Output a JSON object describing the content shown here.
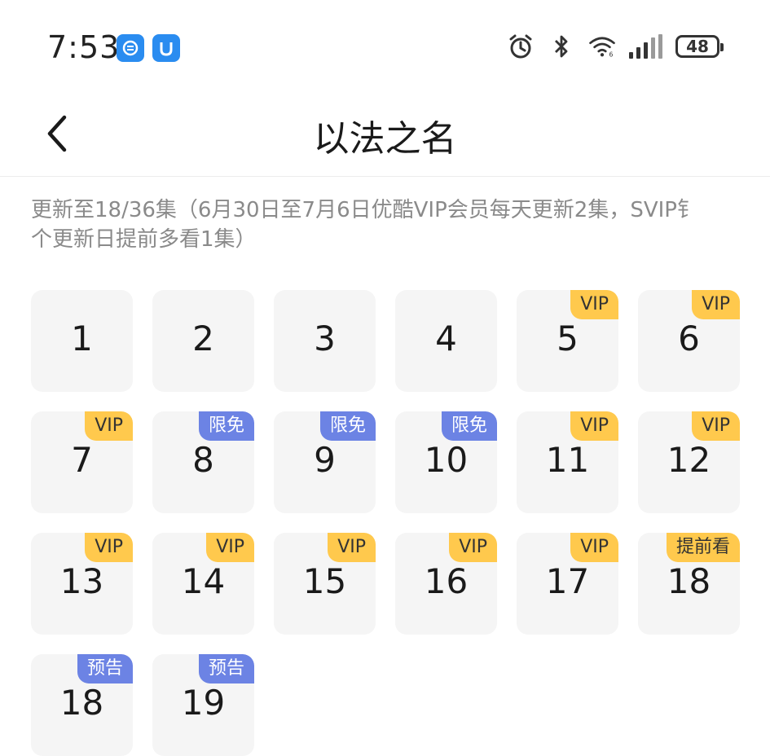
{
  "status_bar": {
    "time": "7:53",
    "battery": "48",
    "icons": [
      "app-sync-icon",
      "app-shield-icon",
      "alarm-icon",
      "bluetooth-icon",
      "wifi-icon",
      "signal-icon",
      "battery-icon"
    ]
  },
  "header": {
    "title": "以法之名",
    "back_icon": "chevron-left-icon"
  },
  "description": {
    "line1": "更新至18/36集（6月30日至7月6日优酷VIP会员每天更新2集，SVIP钅",
    "line2": "个更新日提前多看1集）"
  },
  "colors": {
    "vip_badge": "#ffc94d",
    "free_badge": "#6c83e4",
    "tile_bg": "#f5f5f5"
  },
  "episodes": [
    {
      "num": "1",
      "badge": ""
    },
    {
      "num": "2",
      "badge": ""
    },
    {
      "num": "3",
      "badge": ""
    },
    {
      "num": "4",
      "badge": ""
    },
    {
      "num": "5",
      "badge": "VIP"
    },
    {
      "num": "6",
      "badge": "VIP"
    },
    {
      "num": "7",
      "badge": "VIP"
    },
    {
      "num": "8",
      "badge": "限免"
    },
    {
      "num": "9",
      "badge": "限免"
    },
    {
      "num": "10",
      "badge": "限免"
    },
    {
      "num": "11",
      "badge": "VIP"
    },
    {
      "num": "12",
      "badge": "VIP"
    },
    {
      "num": "13",
      "badge": "VIP"
    },
    {
      "num": "14",
      "badge": "VIP"
    },
    {
      "num": "15",
      "badge": "VIP"
    },
    {
      "num": "16",
      "badge": "VIP"
    },
    {
      "num": "17",
      "badge": "VIP"
    },
    {
      "num": "18",
      "badge": "提前看"
    },
    {
      "num": "18",
      "badge": "预告"
    },
    {
      "num": "19",
      "badge": "预告"
    }
  ]
}
